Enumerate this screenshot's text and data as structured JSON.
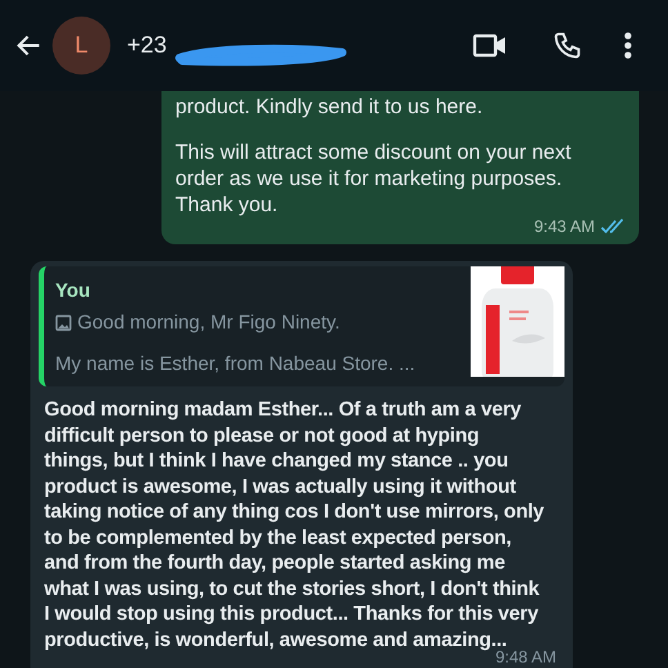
{
  "header": {
    "avatar_letter": "L",
    "title": "+23"
  },
  "messages": [
    {
      "kind": "outgoing",
      "paragraphs": [
        "product. Kindly send it to us here.",
        "This will attract some discount on your next order as we use it for marketing purposes. Thank you."
      ],
      "time": "9:43 AM",
      "read": true
    },
    {
      "kind": "incoming",
      "quote": {
        "author": "You",
        "lines": [
          "Good morning, Mr Figo Ninety.",
          "My name is Esther, from Nabeau Store. ..."
        ]
      },
      "text": "Good morning madam Esther... Of a truth am a very difficult person to please or not good at hyping things, but I think I have changed my stance .. you product is awesome, I was actually using it without taking notice of any thing cos I don't use mirrors, only to be complemented by the least expected person, and from the fourth day, people started asking me what I was using, to cut the stories short, I don't think I would stop using this product... Thanks for this very productive, is wonderful, awesome and amazing...",
      "time": "9:48 AM"
    }
  ]
}
